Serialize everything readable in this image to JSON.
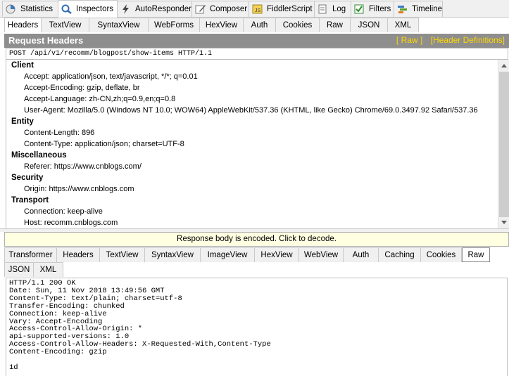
{
  "top_tabs": [
    {
      "label": "Statistics",
      "icon": "statistics-icon"
    },
    {
      "label": "Inspectors",
      "icon": "inspectors-icon"
    },
    {
      "label": "AutoResponder",
      "icon": "autoresponder-icon"
    },
    {
      "label": "Composer",
      "icon": "composer-icon"
    },
    {
      "label": "FiddlerScript",
      "icon": "fiddlerscript-icon"
    },
    {
      "label": "Log",
      "icon": "log-icon"
    },
    {
      "label": "Filters",
      "icon": "filters-icon"
    },
    {
      "label": "Timeline",
      "icon": "timeline-icon"
    }
  ],
  "request_tabs": [
    "Headers",
    "TextView",
    "SyntaxView",
    "WebForms",
    "HexView",
    "Auth",
    "Cookies",
    "Raw",
    "JSON",
    "XML"
  ],
  "request_headers": {
    "title": "Request Headers",
    "raw_link": "[ Raw ]",
    "definitions_link": "[Header Definitions]",
    "request_line": "POST /api/v1/recomm/blogpost/show-items HTTP/1.1",
    "groups": [
      {
        "name": "Client",
        "items": [
          "Accept: application/json, text/javascript, */*; q=0.01",
          "Accept-Encoding: gzip, deflate, br",
          "Accept-Language: zh-CN,zh;q=0.9,en;q=0.8",
          "User-Agent: Mozilla/5.0 (Windows NT 10.0; WOW64) AppleWebKit/537.36 (KHTML, like Gecko) Chrome/69.0.3497.92 Safari/537.36"
        ]
      },
      {
        "name": "Entity",
        "items": [
          "Content-Length: 896",
          "Content-Type: application/json; charset=UTF-8"
        ]
      },
      {
        "name": "Miscellaneous",
        "items": [
          "Referer: https://www.cnblogs.com/"
        ]
      },
      {
        "name": "Security",
        "items": [
          "Origin: https://www.cnblogs.com"
        ]
      },
      {
        "name": "Transport",
        "items": [
          "Connection: keep-alive",
          "Host: recomm.cnblogs.com"
        ]
      }
    ]
  },
  "decode_notice": "Response body is encoded. Click to decode.",
  "response_tabs_row1": [
    "Transformer",
    "Headers",
    "TextView",
    "SyntaxView",
    "ImageView",
    "HexView",
    "WebView",
    "Auth",
    "Caching",
    "Cookies",
    "Raw"
  ],
  "response_tabs_row2": [
    "JSON",
    "XML"
  ],
  "response_raw": "HTTP/1.1 200 OK\nDate: Sun, 11 Nov 2018 13:49:56 GMT\nContent-Type: text/plain; charset=utf-8\nTransfer-Encoding: chunked\nConnection: keep-alive\nVary: Accept-Encoding\nAccess-Control-Allow-Origin: *\napi-supported-versions: 1.0\nAccess-Control-Allow-Headers: X-Requested-With,Content-Type\nContent-Encoding: gzip\n\n1d"
}
